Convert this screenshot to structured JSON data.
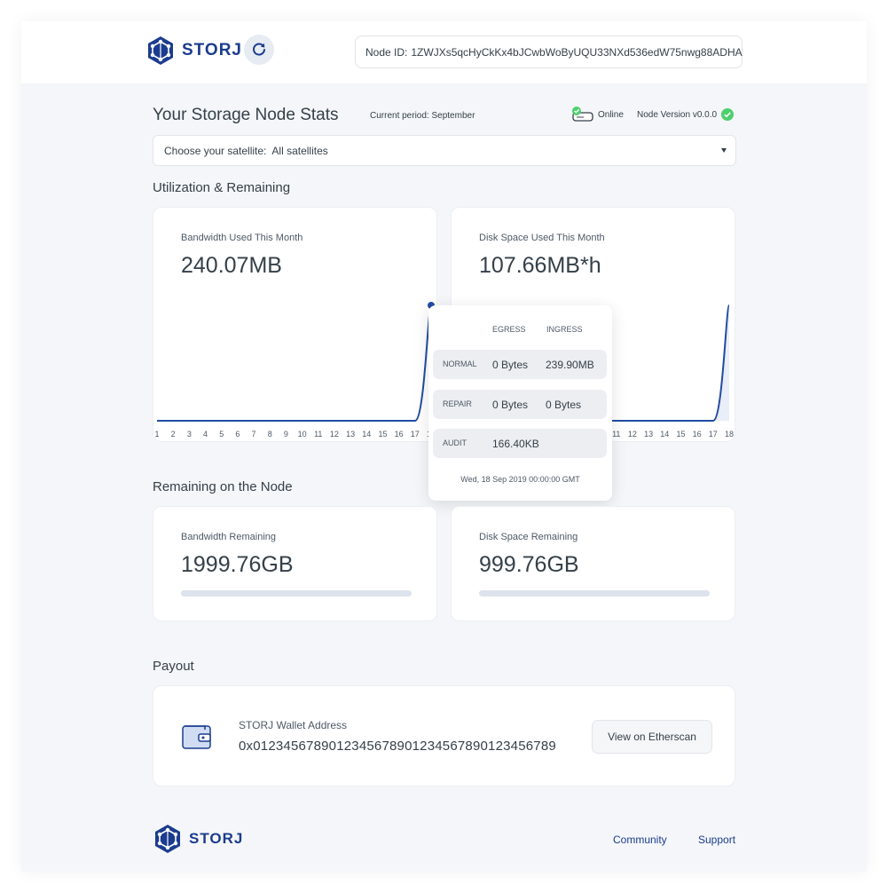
{
  "header": {
    "brand": "STORJ",
    "node_id_label": "Node ID:",
    "node_id_value": "1ZWJXs5qcHyCkKx4bJCwbWoByUQU33NXd536edW75nwg88ADHA"
  },
  "stats": {
    "title": "Your Storage Node Stats",
    "period": "Current period: September",
    "status": "Online",
    "version": "Node Version v0.0.0"
  },
  "satellite": {
    "label": "Choose your satellite:",
    "selected": "All satellites"
  },
  "utilization": {
    "section_title": "Utilization & Remaining",
    "bandwidth": {
      "label": "Bandwidth Used This Month",
      "value": "240.07MB"
    },
    "disk": {
      "label": "Disk Space Used This Month",
      "value": "107.66MB*h"
    }
  },
  "tooltip": {
    "egress_header": "EGRESS",
    "ingress_header": "INGRESS",
    "rows": [
      {
        "name": "NORMAL",
        "egress": "0 Bytes",
        "ingress": "239.90MB"
      },
      {
        "name": "REPAIR",
        "egress": "0 Bytes",
        "ingress": "0 Bytes"
      },
      {
        "name": "AUDIT",
        "egress": "166.40KB",
        "ingress": ""
      }
    ],
    "date": "Wed, 18 Sep 2019 00:00:00 GMT"
  },
  "remaining": {
    "section_title": "Remaining on the Node",
    "bandwidth": {
      "label": "Bandwidth Remaining",
      "value": "1999.76GB"
    },
    "disk": {
      "label": "Disk Space Remaining",
      "value": "999.76GB"
    }
  },
  "payout": {
    "section_title": "Payout",
    "wallet_label": "STORJ Wallet Address",
    "wallet_address": "0x0123456789012345678901234567890123456789",
    "button": "View on Etherscan"
  },
  "footer": {
    "brand": "STORJ",
    "community": "Community",
    "support": "Support"
  },
  "colors": {
    "brand": "#1b3c8e",
    "line": "#224ca5",
    "online": "#4ecf6e",
    "page_bg": "#f4f6f9"
  },
  "chart_data": [
    {
      "type": "line",
      "title": "Bandwidth Used This Month",
      "x": [
        1,
        2,
        3,
        4,
        5,
        6,
        7,
        8,
        9,
        10,
        11,
        12,
        13,
        14,
        15,
        16,
        17,
        18
      ],
      "series": [
        {
          "values": [
            0,
            0,
            0,
            0,
            0,
            0,
            0,
            0,
            0,
            0,
            0,
            0,
            0,
            0,
            0,
            0,
            0,
            240.07
          ]
        }
      ],
      "ylim": [
        0,
        240.07
      ]
    },
    {
      "type": "area",
      "title": "Disk Space Used This Month",
      "x": [
        1,
        2,
        3,
        4,
        5,
        6,
        7,
        8,
        9,
        10,
        11,
        12,
        13,
        14,
        15,
        16,
        17,
        18
      ],
      "series": [
        {
          "values": [
            0,
            0,
            0,
            0,
            0,
            0,
            0,
            0,
            0,
            0,
            0,
            0,
            0,
            0,
            0,
            0,
            0,
            107.66
          ]
        }
      ],
      "ylim": [
        0,
        107.66
      ]
    }
  ]
}
